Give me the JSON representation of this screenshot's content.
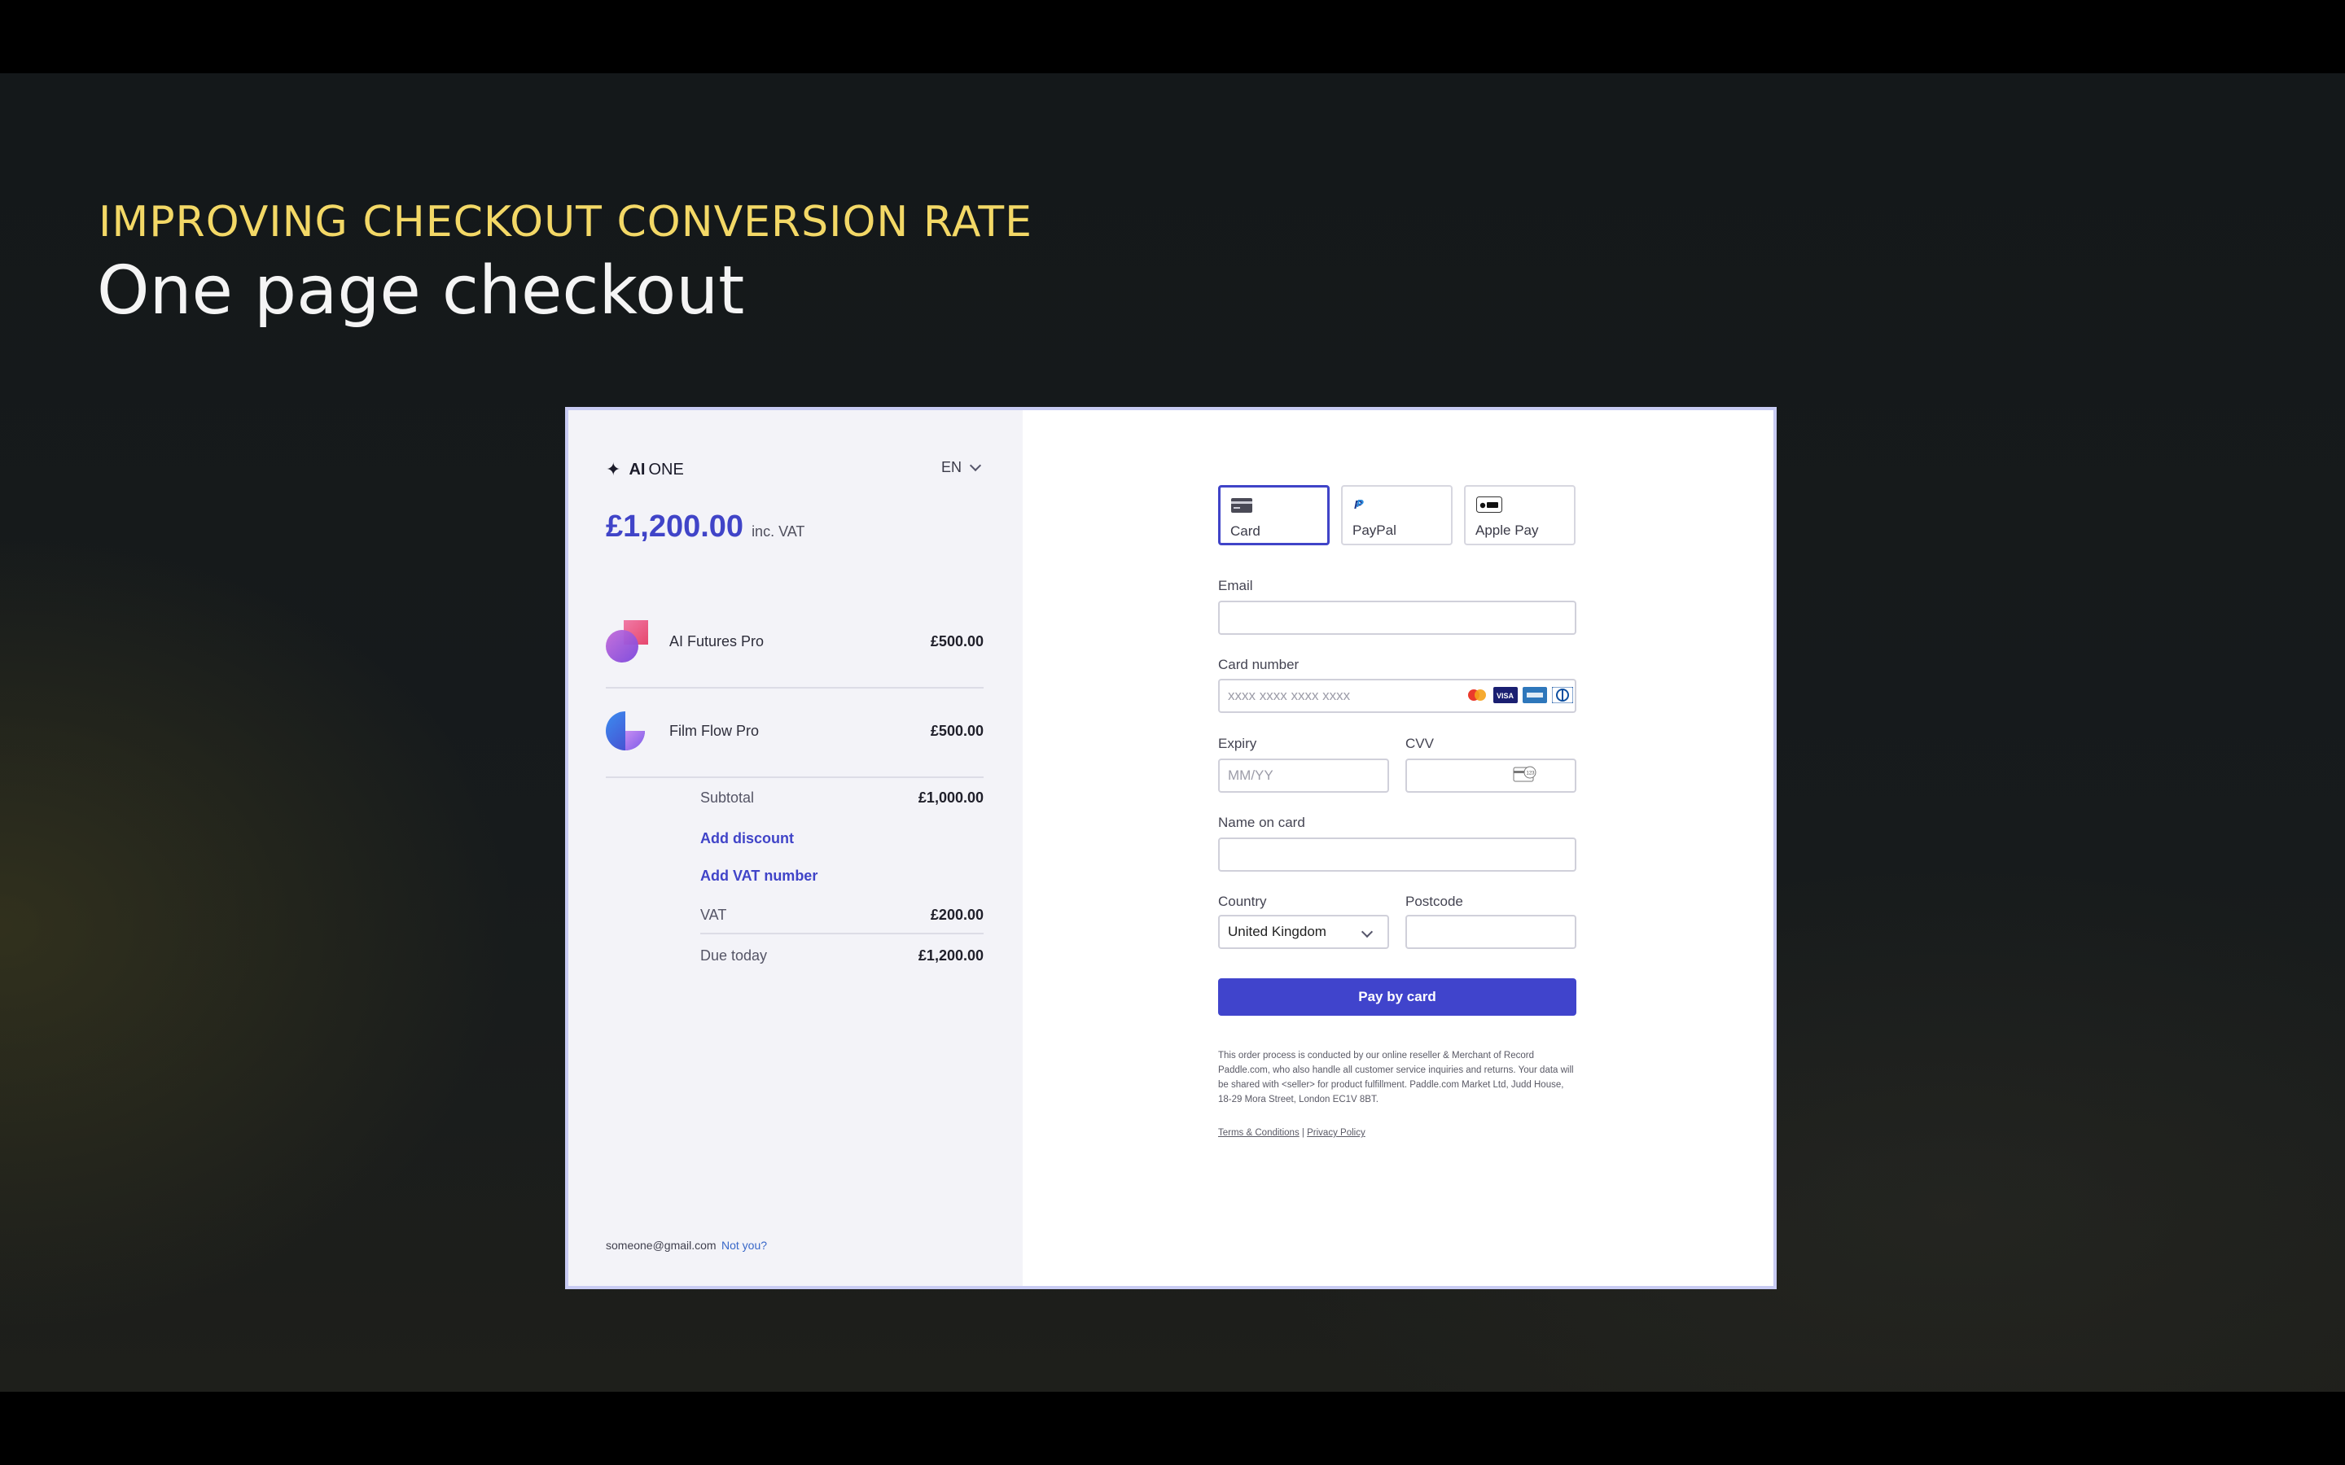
{
  "slide": {
    "eyebrow": "IMPROVING CHECKOUT CONVERSION RATE",
    "headline": "One page checkout"
  },
  "colors": {
    "accent": "#4044c8",
    "eyebrow": "#f3d866",
    "panel_bg": "#f3f3f8"
  },
  "checkout": {
    "brand": {
      "icon": "sparkle-icon",
      "bold": "AI",
      "regular": "ONE"
    },
    "language": "EN",
    "total": {
      "amount": "£1,200.00",
      "suffix": "inc. VAT"
    },
    "items": [
      {
        "name": "AI Futures Pro",
        "price": "£500.00",
        "icon": "ai-futures-product-icon"
      },
      {
        "name": "Film Flow Pro",
        "price": "£500.00",
        "icon": "film-flow-product-icon"
      }
    ],
    "summary": {
      "subtotal_label": "Subtotal",
      "subtotal_value": "£1,000.00",
      "add_discount": "Add discount",
      "add_vat_number": "Add VAT number",
      "vat_label": "VAT",
      "vat_value": "£200.00",
      "due_label": "Due today",
      "due_value": "£1,200.00"
    },
    "footer": {
      "email": "someone@gmail.com",
      "not_you": "Not you?"
    },
    "payment_methods": [
      {
        "label": "Card",
        "icon": "credit-card-icon",
        "selected": true
      },
      {
        "label": "PayPal",
        "icon": "paypal-icon",
        "selected": false
      },
      {
        "label": "Apple Pay",
        "icon": "apple-pay-icon",
        "selected": false
      }
    ],
    "form": {
      "email_label": "Email",
      "email_value": "",
      "card_number_label": "Card number",
      "card_number_placeholder": "xxxx xxxx xxxx xxxx",
      "card_logos": [
        "mastercard-icon",
        "visa-icon",
        "amex-icon",
        "diners-icon"
      ],
      "expiry_label": "Expiry",
      "expiry_placeholder": "MM/YY",
      "cvv_label": "CVV",
      "name_label": "Name on card",
      "country_label": "Country",
      "country_value": "United Kingdom",
      "postcode_label": "Postcode",
      "pay_button": "Pay by card"
    },
    "legal": {
      "text": "This order process is conducted by our online reseller & Merchant of Record Paddle.com, who also handle all customer service inquiries and returns. Your data will be shared with <seller> for product fulfillment. Paddle.com Market Ltd, Judd House, 18-29 Mora Street, London EC1V 8BT.",
      "terms": "Terms & Conditions",
      "separator": "|",
      "privacy": "Privacy Policy"
    }
  }
}
